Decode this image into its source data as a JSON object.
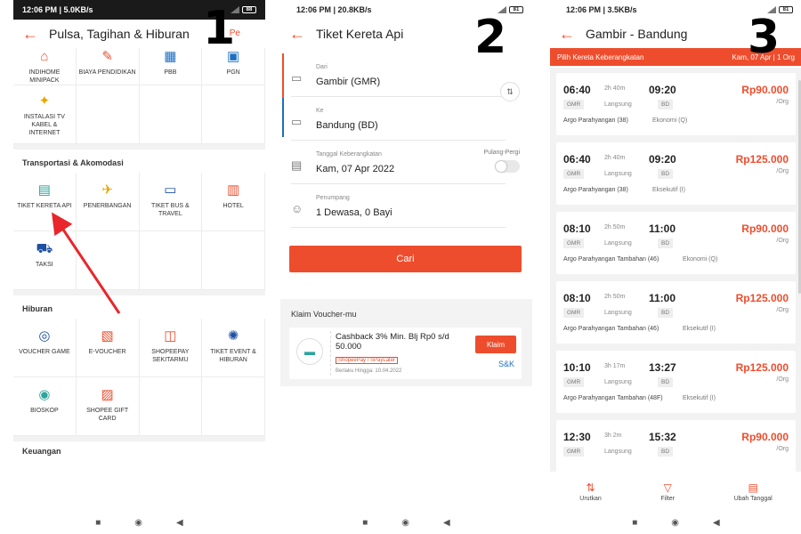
{
  "status": {
    "s1": {
      "time": "12:06 PM | 5.0KB/s",
      "battery": "88"
    },
    "s2": {
      "time": "12:06 PM | 20.8KB/s",
      "battery": "81"
    },
    "s3": {
      "time": "12:06 PM | 3.5KB/s",
      "battery": "81"
    }
  },
  "step_numbers": [
    "1",
    "2",
    "3"
  ],
  "screen1": {
    "title": "Pulsa, Tagihan & Hiburan",
    "title_extra": "Pe",
    "top_items": [
      {
        "label": "INDIHOME MINIPACK",
        "icon": "house-icon"
      },
      {
        "label": "BIAYA PENDIDIKAN",
        "icon": "education-icon"
      },
      {
        "label": "PBB",
        "icon": "building-icon"
      },
      {
        "label": "PGN",
        "icon": "gas-icon"
      },
      {
        "label": "INSTALASI TV KABEL & INTERNET",
        "icon": "tv-install-icon"
      }
    ],
    "sec_transport": "Transportasi & Akomodasi",
    "transport_items": [
      {
        "label": "TIKET KERETA API",
        "icon": "train-icon"
      },
      {
        "label": "PENERBANGAN",
        "icon": "plane-icon"
      },
      {
        "label": "TIKET BUS & TRAVEL",
        "icon": "bus-icon"
      },
      {
        "label": "HOTEL",
        "icon": "hotel-icon"
      },
      {
        "label": "TAKSI",
        "icon": "taxi-icon"
      }
    ],
    "sec_hiburan": "Hiburan",
    "hiburan_items": [
      {
        "label": "VOUCHER GAME",
        "icon": "gamepad-icon"
      },
      {
        "label": "E-VOUCHER",
        "icon": "voucher-icon"
      },
      {
        "label": "SHOPEEPAY SEKITARMU",
        "icon": "ticket-icon"
      },
      {
        "label": "TIKET EVENT & HIBURAN",
        "icon": "event-icon"
      },
      {
        "label": "BIOSKOP",
        "icon": "cinema-icon"
      },
      {
        "label": "SHOPEE GIFT CARD",
        "icon": "giftcard-icon"
      }
    ],
    "sec_keuangan": "Keuangan",
    "accent": "#ee4d2d"
  },
  "screen2": {
    "title": "Tiket Kereta Api",
    "from_label": "Dari",
    "from_value": "Gambir (GMR)",
    "to_label": "Ke",
    "to_value": "Bandung (BD)",
    "date_label": "Tanggal Keberangkatan",
    "date_value": "Kam, 07 Apr 2022",
    "roundtrip_label": "Pulang-Pergi",
    "pax_label": "Penumpang",
    "pax_value": "1 Dewasa, 0 Bayi",
    "search_button": "Cari",
    "voucher_section": "Klaim Voucher-mu",
    "voucher_text": "Cashback 3% Min. Blj Rp0 s/d 50.000",
    "voucher_badge": "ShopeePay / SPayLater",
    "voucher_valid": "Berlaku Hingga: 10.04.2022",
    "claim_button": "Klaim",
    "snk": "S&K"
  },
  "screen3": {
    "title": "Gambir - Bandung",
    "banner_left": "Pilih Kereta Keberangkatan",
    "banner_right": "Kam, 07 Apr | 1 Org",
    "trains": [
      {
        "dep": "06:40",
        "dur": "2h 40m",
        "arr": "09:20",
        "price": "Rp90.000",
        "per": "/Org",
        "from": "GMR",
        "kind": "Langsung",
        "to": "BD",
        "name": "Argo Parahyangan (38)",
        "cls": "Ekonomi (Q)"
      },
      {
        "dep": "06:40",
        "dur": "2h 40m",
        "arr": "09:20",
        "price": "Rp125.000",
        "per": "/Org",
        "from": "GMR",
        "kind": "Langsung",
        "to": "BD",
        "name": "Argo Parahyangan (38)",
        "cls": "Eksekutif (I)"
      },
      {
        "dep": "08:10",
        "dur": "2h 50m",
        "arr": "11:00",
        "price": "Rp90.000",
        "per": "/Org",
        "from": "GMR",
        "kind": "Langsung",
        "to": "BD",
        "name": "Argo Parahyangan Tambahan (46)",
        "cls": "Ekonomi (Q)"
      },
      {
        "dep": "08:10",
        "dur": "2h 50m",
        "arr": "11:00",
        "price": "Rp125.000",
        "per": "/Org",
        "from": "GMR",
        "kind": "Langsung",
        "to": "BD",
        "name": "Argo Parahyangan Tambahan (46)",
        "cls": "Eksekutif (I)"
      },
      {
        "dep": "10:10",
        "dur": "3h 17m",
        "arr": "13:27",
        "price": "Rp125.000",
        "per": "/Org",
        "from": "GMR",
        "kind": "Langsung",
        "to": "BD",
        "name": "Argo Parahyangan Tambahan (48F)",
        "cls": "Eksekutif (I)"
      },
      {
        "dep": "12:30",
        "dur": "3h 2m",
        "arr": "15:32",
        "price": "Rp90.000",
        "per": "/Org",
        "from": "GMR",
        "kind": "Langsung",
        "to": "BD",
        "name": "",
        "cls": ""
      }
    ],
    "bottom": [
      {
        "label": "Urutkan",
        "icon": "sort-icon"
      },
      {
        "label": "Filter",
        "icon": "filter-icon"
      },
      {
        "label": "Ubah Tanggal",
        "icon": "calendar-icon"
      }
    ]
  }
}
